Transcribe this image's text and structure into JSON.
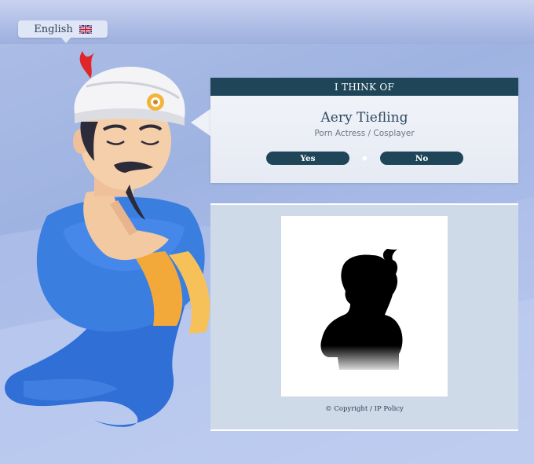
{
  "language": {
    "label": "English",
    "flag_icon": "uk-flag-icon"
  },
  "result": {
    "header": "I THINK OF",
    "name": "Aery Tiefling",
    "description": "Porn Actress / Cosplayer",
    "yes_label": "Yes",
    "no_label": "No"
  },
  "footer": {
    "copyright": "© Copyright / IP Policy"
  },
  "colors": {
    "header_bg": "#1f4658",
    "button_bg": "#1f4658",
    "panel_bg": "#cfdae8"
  }
}
